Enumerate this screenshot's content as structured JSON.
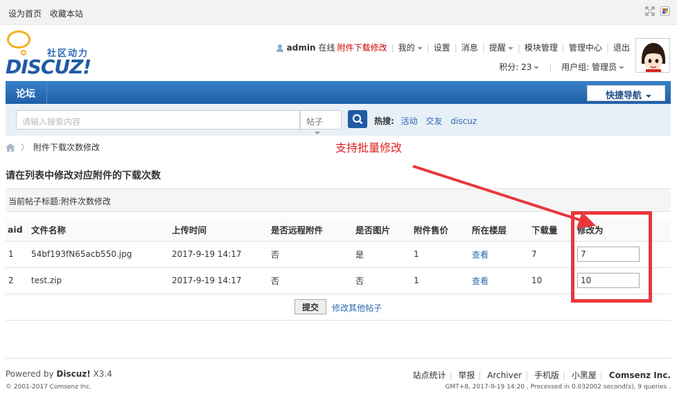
{
  "topbar": {
    "set_home": "设为首页",
    "bookmark": "收藏本站"
  },
  "logo": {
    "slogan": "社区动力",
    "brand": "DISCUZ!"
  },
  "user": {
    "name": "admin",
    "status": "在线",
    "plugin_link": "附件下载修改",
    "menu": [
      "我的",
      "设置",
      "消息",
      "提醒",
      "模块管理",
      "管理中心",
      "退出"
    ],
    "credits": "积分: 23",
    "group": "用户组: 管理员"
  },
  "nav": {
    "forum": "论坛",
    "quick_nav": "快捷导航"
  },
  "search": {
    "placeholder": "请输入搜索内容",
    "type": "帖子",
    "hot_label": "热搜:",
    "hot_terms": [
      "活动",
      "交友",
      "discuz"
    ]
  },
  "breadcrumb": {
    "current": "附件下载次数修改"
  },
  "annotation": "支持批量修改",
  "page": {
    "title": "请在列表中修改对应附件的下载次数",
    "thread_title": "当前帖子标题:附件次数修改"
  },
  "table": {
    "headers": [
      "aid",
      "文件名称",
      "上传时间",
      "是否远程附件",
      "是否图片",
      "附件售价",
      "所在楼层",
      "下载量",
      "修改为"
    ],
    "rows": [
      {
        "aid": "1",
        "name": "54bf193fN65acb550.jpg",
        "time": "2017-9-19 14:17",
        "remote": "否",
        "image": "是",
        "price": "1",
        "floor": "查看",
        "downloads": "7",
        "edit": "7"
      },
      {
        "aid": "2",
        "name": "test.zip",
        "time": "2017-9-19 14:17",
        "remote": "否",
        "image": "否",
        "price": "1",
        "floor": "查看",
        "downloads": "10",
        "edit": "10"
      }
    ]
  },
  "actions": {
    "submit": "提交",
    "other": "修改其他帖子"
  },
  "footer": {
    "powered_prefix": "Powered by",
    "powered_brand": "Discuz!",
    "version": "X3.4",
    "copyright": "© 2001-2017 Comsenz Inc.",
    "links": [
      "站点统计",
      "举报",
      "Archiver",
      "手机版",
      "小黑屋"
    ],
    "company": "Comsenz Inc.",
    "gmt": "GMT+8, 2017-9-19 14:20 , Processed in 0.032002 second(s), 9 queries ."
  },
  "colors": {
    "accent": "#1f5aa6",
    "annotation_red": "#e8383d",
    "link": "#2b69b2"
  }
}
